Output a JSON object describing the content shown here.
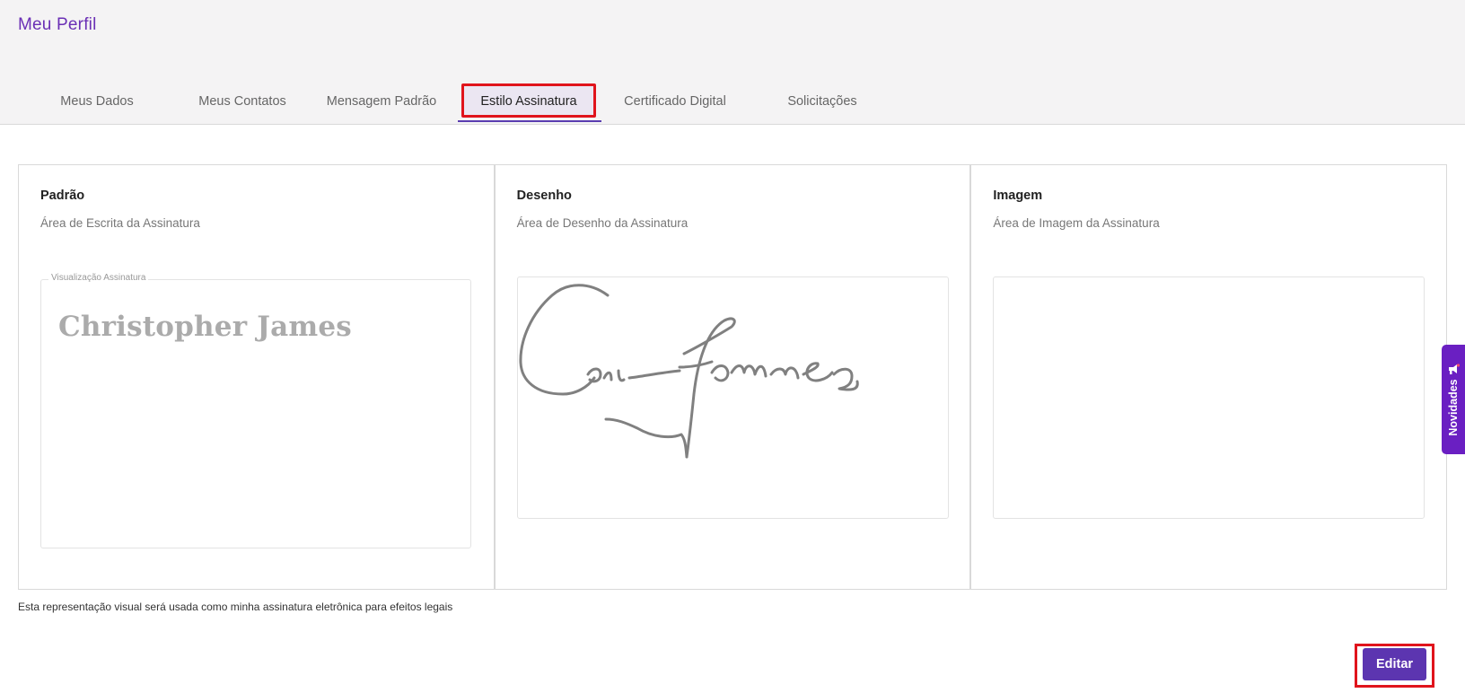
{
  "header": {
    "title": "Meu Perfil",
    "tabs": [
      {
        "label": "Meus Dados"
      },
      {
        "label": "Meus Contatos"
      },
      {
        "label": "Mensagem Padrão"
      },
      {
        "label": "Estilo Assinatura"
      },
      {
        "label": "Certificado Digital"
      },
      {
        "label": "Solicitações"
      }
    ],
    "active_tab": "Estilo Assinatura"
  },
  "panels": {
    "standard": {
      "title": "Padrão",
      "subtitle": "Área de Escrita da Assinatura",
      "preview_legend": "Visualização Assinatura",
      "signature_text": "Christopher James"
    },
    "drawing": {
      "title": "Desenho",
      "subtitle": "Área de Desenho da Assinatura",
      "signature_icon": "handwritten-signature"
    },
    "image": {
      "title": "Imagem",
      "subtitle": "Área de Imagem da Assinatura"
    }
  },
  "legal_note": "Esta representação visual será usada como minha assinatura eletrônica para efeitos legais",
  "actions": {
    "edit_label": "Editar"
  },
  "side_widget": {
    "label": "Novidades",
    "icon": "megaphone-icon"
  },
  "colors": {
    "brand_purple": "#5c35b0",
    "title_purple": "#6a2fb5",
    "widget_purple": "#6a1fc2",
    "highlight_red": "#e0141c",
    "signature_gray": "#808080"
  }
}
